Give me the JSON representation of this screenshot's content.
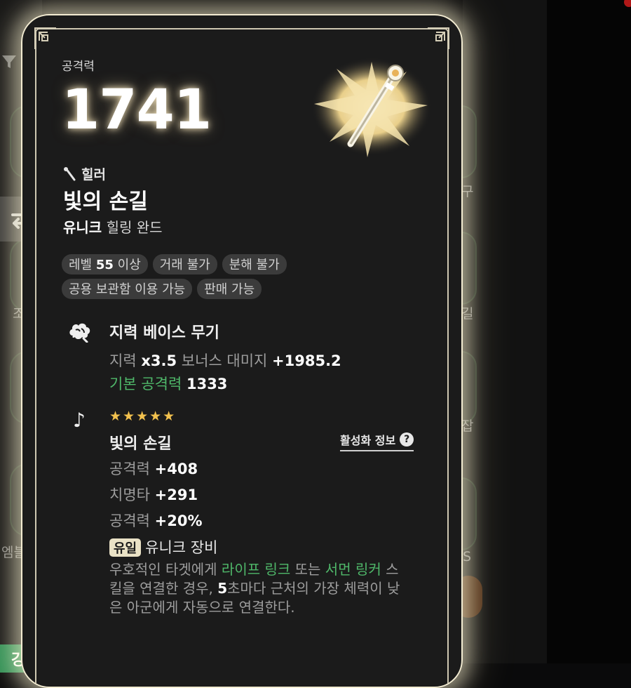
{
  "background": {
    "left_labels": [
      "조",
      "엠블"
    ],
    "right_labels": [
      "구",
      "길",
      "잡",
      "S"
    ],
    "bottom_button_label": "강화하기"
  },
  "card": {
    "power_label": "공격력",
    "power_value": "1741",
    "class_name": "힐러",
    "item_name": "빛의 손길",
    "item_type_prefix": "유니크",
    "item_type": "힐링 완드",
    "tags_row1": [
      {
        "pre": "레벨 ",
        "bold": "55",
        "post": " 이상"
      },
      {
        "pre": "거래 불가",
        "bold": "",
        "post": ""
      },
      {
        "pre": "분해 불가",
        "bold": "",
        "post": ""
      }
    ],
    "tags_row2": [
      {
        "pre": "공용 보관함 이용 가능",
        "bold": "",
        "post": ""
      },
      {
        "pre": "판매 가능",
        "bold": "",
        "post": ""
      }
    ],
    "base": {
      "title": "지력 베이스 무기",
      "stat_label": "지력 ",
      "stat_mult": "x3.5",
      "bonus_label": " 보너스 대미지 ",
      "bonus_value": "+1985.2",
      "atk_label": "기본 공격력",
      "atk_value": "1333"
    },
    "set": {
      "stars": "★★★★★",
      "name": "빛의 손길",
      "activation_label": "활성화 정보",
      "stats": [
        {
          "label": "공격력 ",
          "value": "+408"
        },
        {
          "label": "치명타 ",
          "value": "+291"
        },
        {
          "label": "공격력 ",
          "value": "+20%"
        }
      ],
      "unique_badge": "유일",
      "unique_label": "유니크 장비",
      "desc_1": "우호적인 타겟에게 ",
      "desc_link1": "라이프 링크",
      "desc_2": " 또는 ",
      "desc_link2": "서먼 링커",
      "desc_3": " 스킬을 연결한 경우, ",
      "desc_num": "5",
      "desc_4": "초마다 근처의 가장 체력이 낮은 아군에게 자동으로 연결한다."
    }
  },
  "colors": {
    "accent_green": "#4fb86a",
    "star_gold": "#f2c14e",
    "card_border": "#f3ecd2"
  }
}
